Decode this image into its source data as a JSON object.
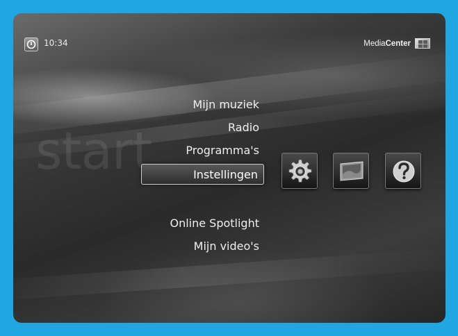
{
  "header": {
    "clock": "10:34",
    "brand_light": "Media",
    "brand_bold": "Center"
  },
  "background_watermark": "start",
  "menu": {
    "items": [
      {
        "label": "Mijn muziek"
      },
      {
        "label": "Radio"
      },
      {
        "label": "Programma's"
      },
      {
        "label": "Instellingen",
        "selected": true
      },
      {
        "label": "Online Spotlight"
      },
      {
        "label": "Mijn video's"
      }
    ]
  },
  "tiles": [
    {
      "icon": "gear-settings-icon"
    },
    {
      "icon": "monitor-display-icon"
    },
    {
      "icon": "help-question-icon"
    }
  ],
  "colors": {
    "frame": "#20a7e2",
    "text": "#efefef"
  }
}
